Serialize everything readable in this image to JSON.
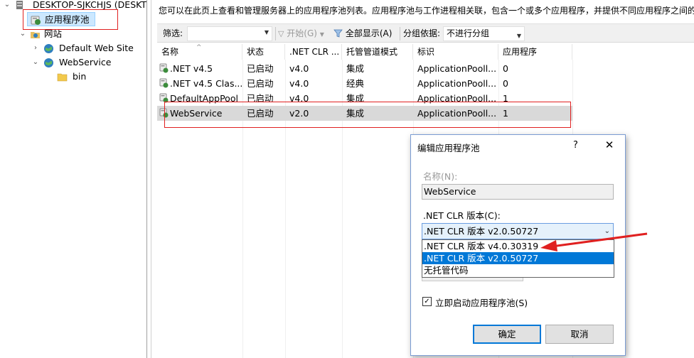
{
  "tree": {
    "server": "DESKTOP-SJKCHJS (DESKTOP",
    "app_pools": "应用程序池",
    "sites": "网站",
    "site_default": "Default Web Site",
    "site_webservice": "WebService",
    "folder_bin": "bin"
  },
  "description": "您可以在此页上查看和管理服务器上的应用程序池列表。应用程序池与工作进程相关联，包含一个或多个应用程序，并提供不同应用程序之间的",
  "toolbar": {
    "filter_label": "筛选:",
    "start_label": "开始(G)",
    "show_all_label": "全部显示(A)",
    "group_label": "分组依据:",
    "group_value": "不进行分组"
  },
  "grid": {
    "headers": [
      "名称",
      "状态",
      ".NET CLR ...",
      "托管管道模式",
      "标识",
      "应用程序"
    ],
    "rows": [
      {
        "name": ".NET v4.5",
        "status": "已启动",
        "clr": "v4.0",
        "pipeline": "集成",
        "identity": "ApplicationPooll...",
        "apps": "0"
      },
      {
        "name": ".NET v4.5 Clas...",
        "status": "已启动",
        "clr": "v4.0",
        "pipeline": "经典",
        "identity": "ApplicationPooll...",
        "apps": "0"
      },
      {
        "name": "DefaultAppPool",
        "status": "已启动",
        "clr": "v4.0",
        "pipeline": "集成",
        "identity": "ApplicationPooll...",
        "apps": "1"
      },
      {
        "name": "WebService",
        "status": "已启动",
        "clr": "v2.0",
        "pipeline": "集成",
        "identity": "ApplicationPooll...",
        "apps": "1"
      }
    ]
  },
  "dialog": {
    "title": "编辑应用程序池",
    "help": "?",
    "close": "✕",
    "name_label": "名称(N):",
    "name_value": "WebService",
    "clr_label": ".NET CLR 版本(C):",
    "clr_selected": ".NET CLR 版本 v2.0.50727",
    "clr_options": [
      ".NET CLR 版本 v4.0.30319",
      ".NET CLR 版本 v2.0.50727",
      "无托管代码"
    ],
    "autostart_label": "立即启动应用程序池(S)",
    "autostart_checked": true,
    "ok": "确定",
    "cancel": "取消"
  },
  "colors": {
    "annotation_red": "#e02020",
    "highlight_blue": "#0078d7"
  }
}
